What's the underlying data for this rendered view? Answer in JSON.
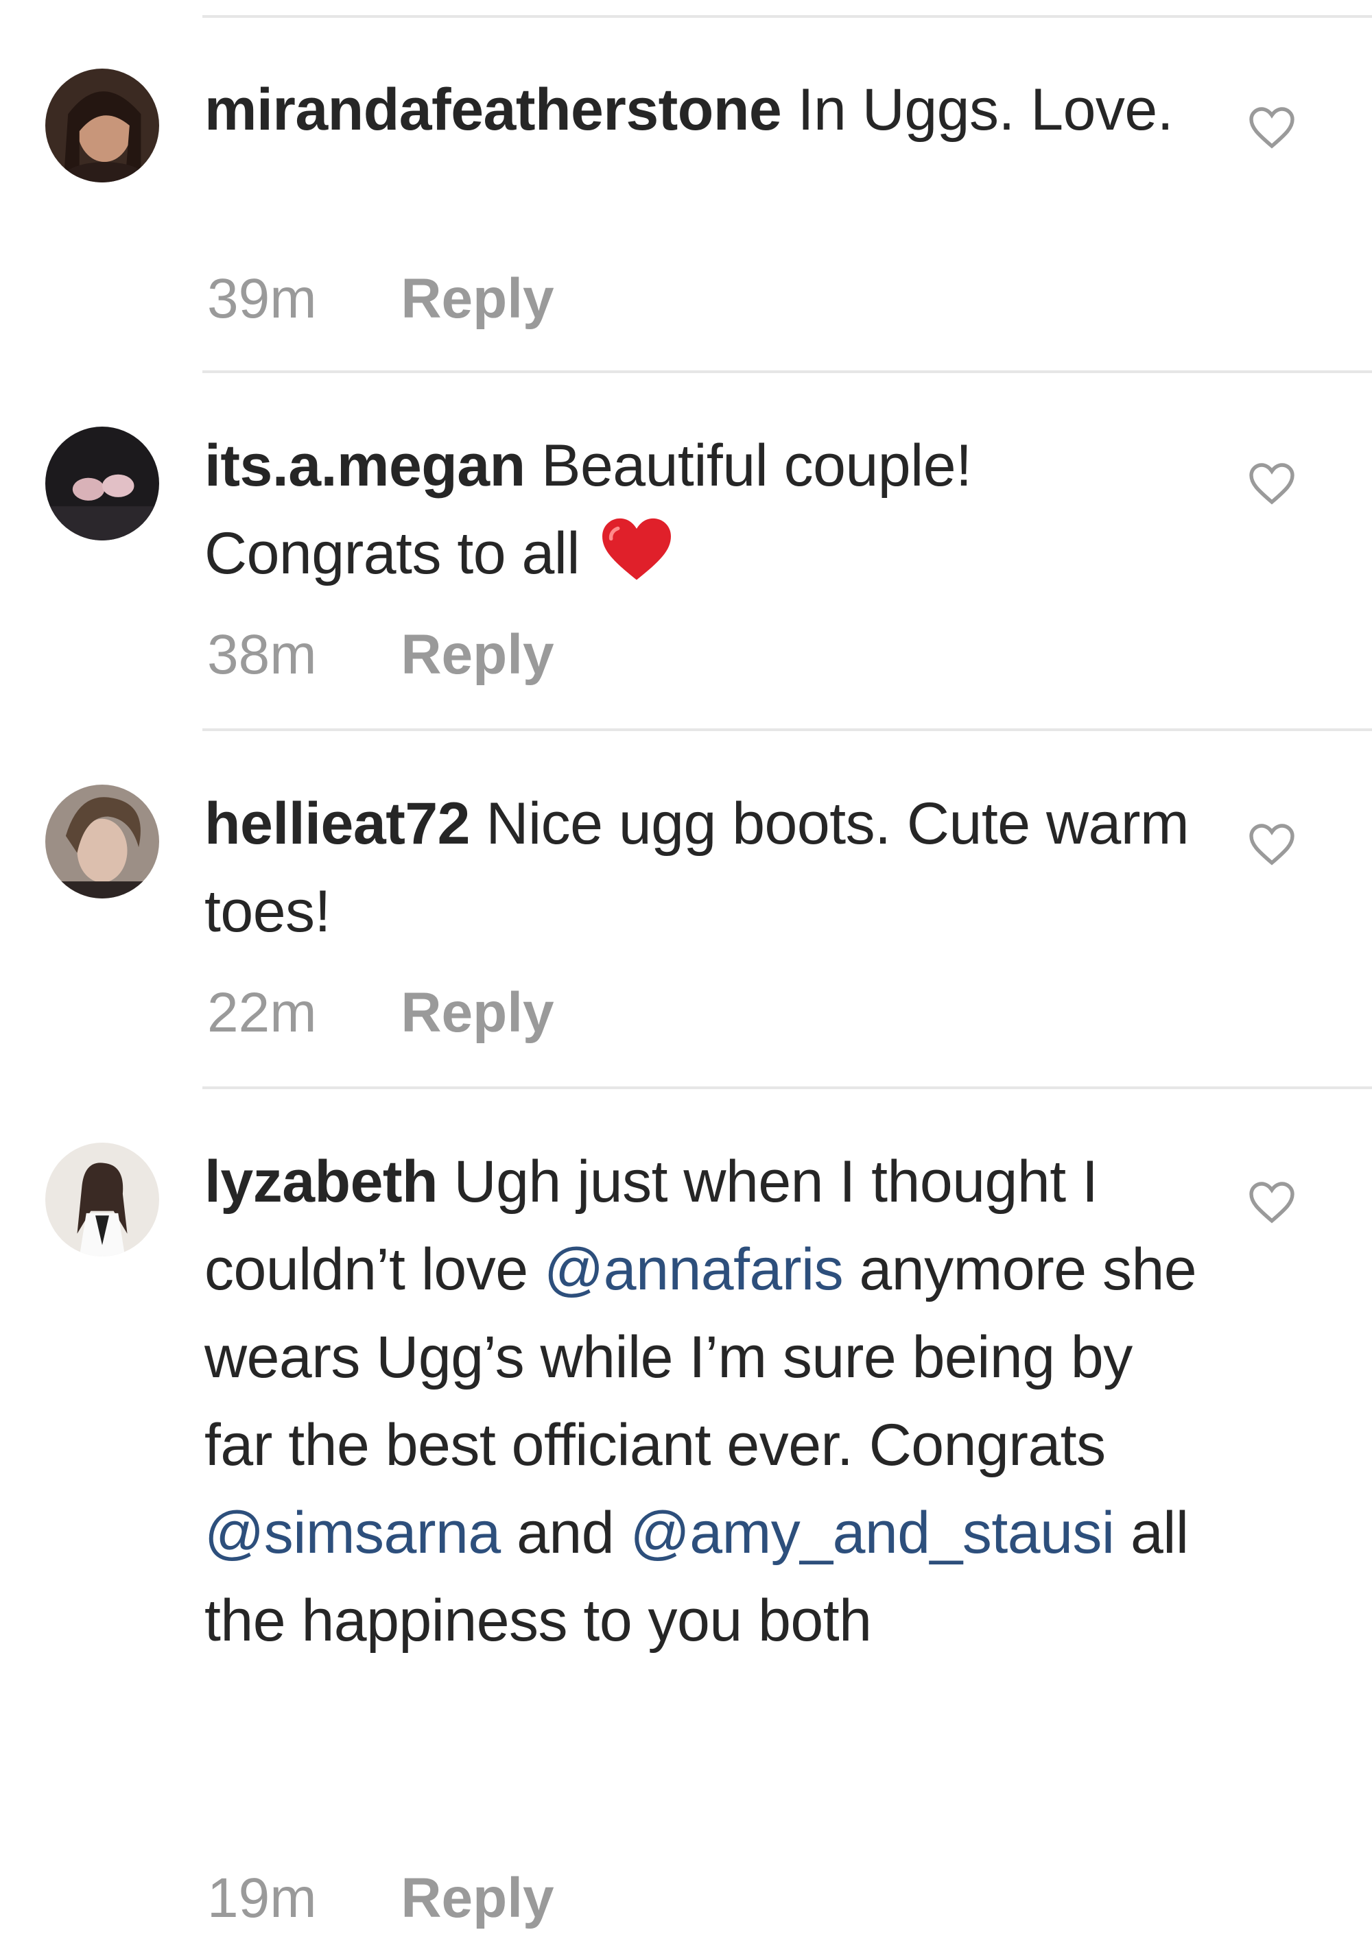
{
  "comments": [
    {
      "username": "mirandafeatherstone",
      "text": "In Uggs. Love.",
      "time": "39m",
      "reply_label": "Reply"
    },
    {
      "username": "its.a.megan",
      "text": "Beautiful couple! Congrats to all",
      "emoji": "red-heart-emoji",
      "time": "38m",
      "reply_label": "Reply"
    },
    {
      "username": "hellieat72",
      "text": "Nice ugg boots. Cute warm toes!",
      "time": "22m",
      "reply_label": "Reply"
    },
    {
      "username": "lyzabeth",
      "text_parts": [
        "Ugh just when I thought I couldn’t love ",
        "@annafaris",
        " anymore she wears Ugg’s while I’m sure being by far the best officiant ever. Congrats ",
        "@simsarna",
        " and ",
        "@amy_and_stausi",
        " all the happiness to you both"
      ],
      "time": "19m",
      "reply_label": "Reply"
    }
  ],
  "colors": {
    "text": "#262626",
    "meta": "#9a9a9a",
    "mention": "#2d4f7c",
    "divider": "#e6e6e6"
  },
  "icons": {
    "like": "heart-outline-icon",
    "avatar": "user-avatar"
  }
}
